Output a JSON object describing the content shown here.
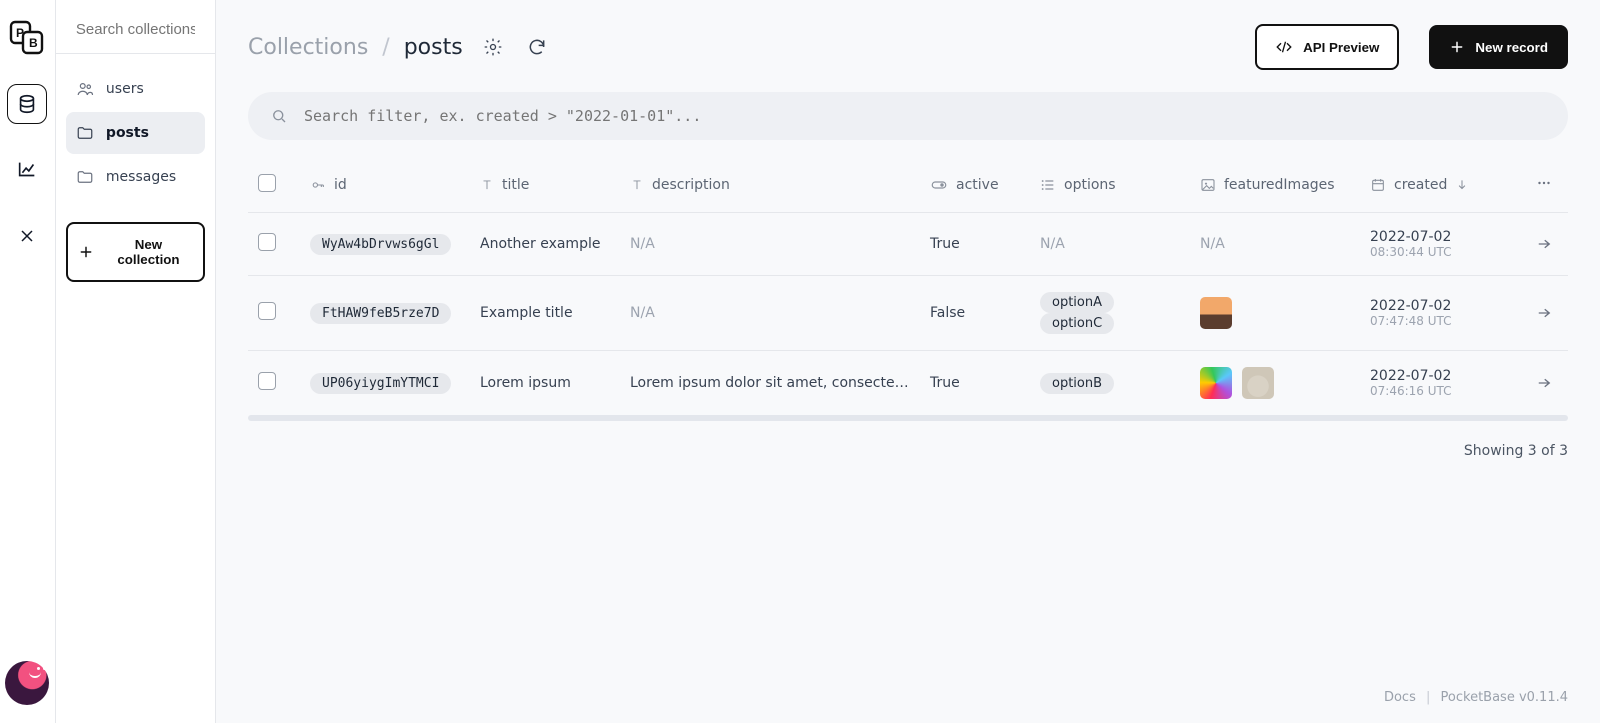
{
  "sidebar": {
    "search_placeholder": "Search collections...",
    "items": [
      {
        "label": "users",
        "icon": "people-icon",
        "active": false
      },
      {
        "label": "posts",
        "icon": "folder-icon",
        "active": true
      },
      {
        "label": "messages",
        "icon": "folder-icon",
        "active": false
      }
    ],
    "new_collection_label": "New collection"
  },
  "header": {
    "breadcrumb_root": "Collections",
    "breadcrumb_sep": "/",
    "breadcrumb_leaf": "posts",
    "api_preview_label": "API Preview",
    "new_record_label": "New record"
  },
  "filter": {
    "placeholder": "Search filter, ex. created > \"2022-01-01\"..."
  },
  "table": {
    "columns": {
      "id": "id",
      "title": "title",
      "description": "description",
      "active": "active",
      "options": "options",
      "featuredImages": "featuredImages",
      "created": "created"
    },
    "na_label": "N/A",
    "rows": [
      {
        "id": "WyAw4bDrvws6gGl",
        "title": "Another example",
        "description": "",
        "active": "True",
        "options": [],
        "featuredImages": 0,
        "created_date": "2022-07-02",
        "created_time": "08:30:44 UTC"
      },
      {
        "id": "FtHAW9feB5rze7D",
        "title": "Example title",
        "description": "",
        "active": "False",
        "options": [
          "optionA",
          "optionC"
        ],
        "featuredImages": 1,
        "created_date": "2022-07-02",
        "created_time": "07:47:48 UTC"
      },
      {
        "id": "UP06yiygImYTMCI",
        "title": "Lorem ipsum",
        "description": "Lorem ipsum dolor sit amet, consectetur adi…",
        "active": "True",
        "options": [
          "optionB"
        ],
        "featuredImages": 2,
        "created_date": "2022-07-02",
        "created_time": "07:46:16 UTC"
      }
    ],
    "showing_text": "Showing 3 of 3"
  },
  "footer": {
    "docs_label": "Docs",
    "version_label": "PocketBase v0.11.4"
  }
}
